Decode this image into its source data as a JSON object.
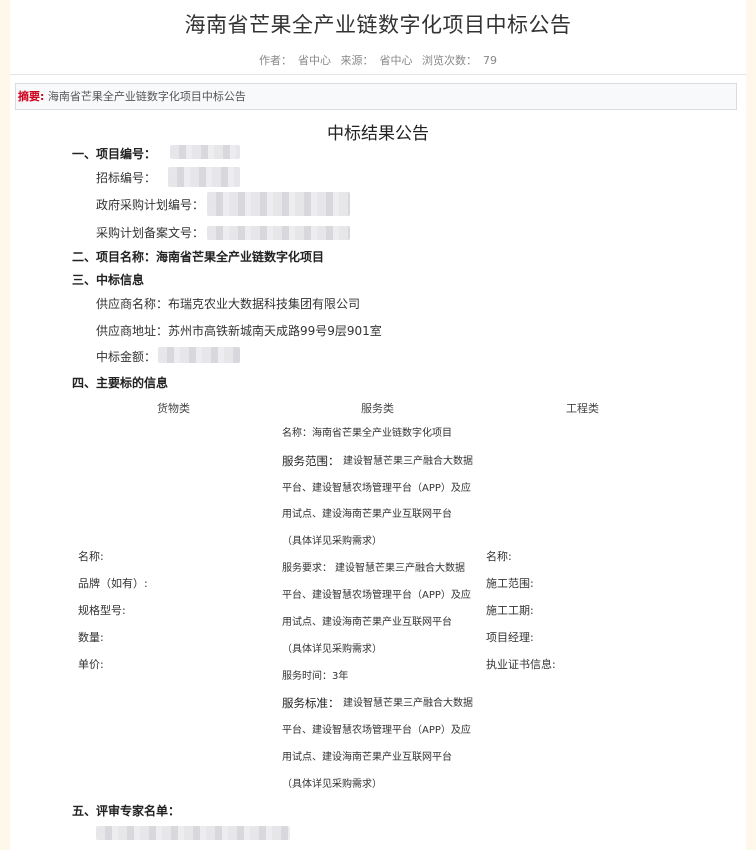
{
  "header": {
    "title": "海南省芒果全产业链数字化项目中标公告",
    "author_label": "作者：",
    "author": "省中心",
    "source_label": "来源：",
    "source": "省中心",
    "views_label": "浏览次数：",
    "views": "79"
  },
  "abstract": {
    "label": "摘要:",
    "text": "海南省芒果全产业链数字化项目中标公告"
  },
  "notice": {
    "heading": "中标结果公告",
    "s1": {
      "title": "一、项目编号：",
      "bid_no_label": "招标编号：",
      "plan_no_label": "政府采购计划编号：",
      "filing_no_label": "采购计划备案文号："
    },
    "s2": {
      "title": "二、项目名称：",
      "value": "海南省芒果全产业链数字化项目"
    },
    "s3": {
      "title": "三、中标信息",
      "supplier_name_label": "供应商名称：",
      "supplier_name": "布瑞克农业大数据科技集团有限公司",
      "supplier_addr_label": "供应商地址：",
      "supplier_addr": "苏州市高铁新城南天成路99号9层901室",
      "amount_label": "中标金额："
    },
    "s4": {
      "title": "四、主要标的信息",
      "goods_head": "货物类",
      "service_head": "服务类",
      "project_head": "工程类",
      "goods": {
        "name": "名称:",
        "brand": "品牌（如有）:",
        "model": "规格型号:",
        "qty": "数量:",
        "price": "单价:"
      },
      "service": {
        "name_line": "名称：海南省芒果全产业链数字化项目",
        "scope_label": "服务范围：",
        "scope_1": "建设智慧芒果三产融合大数据",
        "scope_2": "平台、建设智慧农场管理平台（APP）及应",
        "scope_3": "用试点、建设海南芒果产业互联网平台",
        "scope_4": "（具体详见采购需求）",
        "req_label": "服务要求：",
        "req_1": "建设智慧芒果三产融合大数据",
        "req_2": "平台、建设智慧农场管理平台（APP）及应",
        "req_3": "用试点、建设海南芒果产业互联网平台",
        "req_4": "（具体详见采购需求）",
        "time": "服务时间：3年",
        "std_label": "服务标准：",
        "std_1": "建设智慧芒果三产融合大数据",
        "std_2": "平台、建设智慧农场管理平台（APP）及应",
        "std_3": "用试点、建设海南芒果产业互联网平台",
        "std_4": "（具体详见采购需求）"
      },
      "project": {
        "name": "名称:",
        "scope": "施工范围:",
        "period": "施工工期:",
        "manager": "项目经理:",
        "cert": "执业证书信息:"
      }
    },
    "s5": {
      "title": "五、评审专家名单："
    }
  }
}
